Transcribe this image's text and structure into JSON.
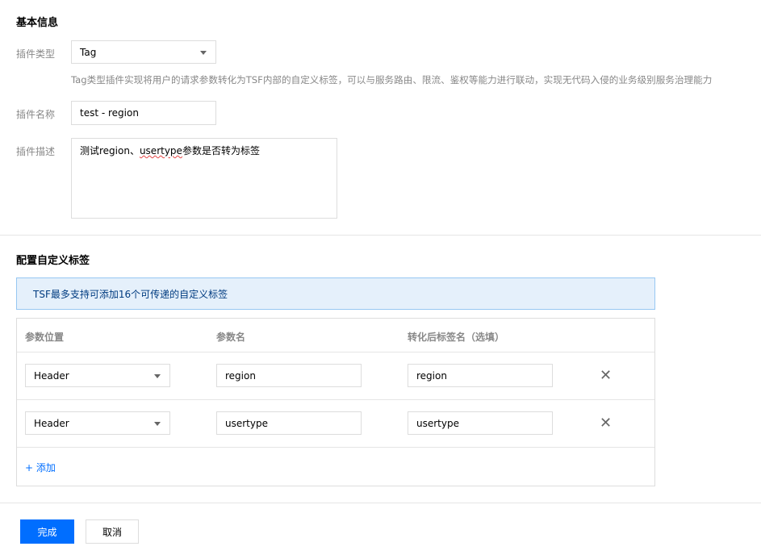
{
  "basic": {
    "title": "基本信息",
    "type_label": "插件类型",
    "type_value": "Tag",
    "type_hint": "Tag类型插件实现将用户的请求参数转化为TSF内部的自定义标签，可以与服务路由、限流、鉴权等能力进行联动，实现无代码入侵的业务级别服务治理能力",
    "name_label": "插件名称",
    "name_value": "test - region",
    "desc_label": "插件描述",
    "desc_prefix": "测试region、",
    "desc_misspelled": "usertype",
    "desc_suffix": "参数是否转为标签"
  },
  "custom": {
    "title": "配置自定义标签",
    "notice": "TSF最多支持可添加16个可传递的自定义标签",
    "columns": [
      "参数位置",
      "参数名",
      "转化后标签名（选填）"
    ],
    "rows": [
      {
        "position": "Header",
        "param": "region",
        "tag": "region"
      },
      {
        "position": "Header",
        "param": "usertype",
        "tag": "usertype"
      }
    ],
    "add_label": "+ 添加"
  },
  "footer": {
    "confirm_label": "完成",
    "cancel_label": "取消"
  },
  "colors": {
    "primary": "#006eff",
    "notice_bg": "#e5f0fb",
    "notice_border": "#97c7f2"
  },
  "icons": {
    "dropdown": "chevron-down-icon",
    "delete": "close-icon"
  }
}
